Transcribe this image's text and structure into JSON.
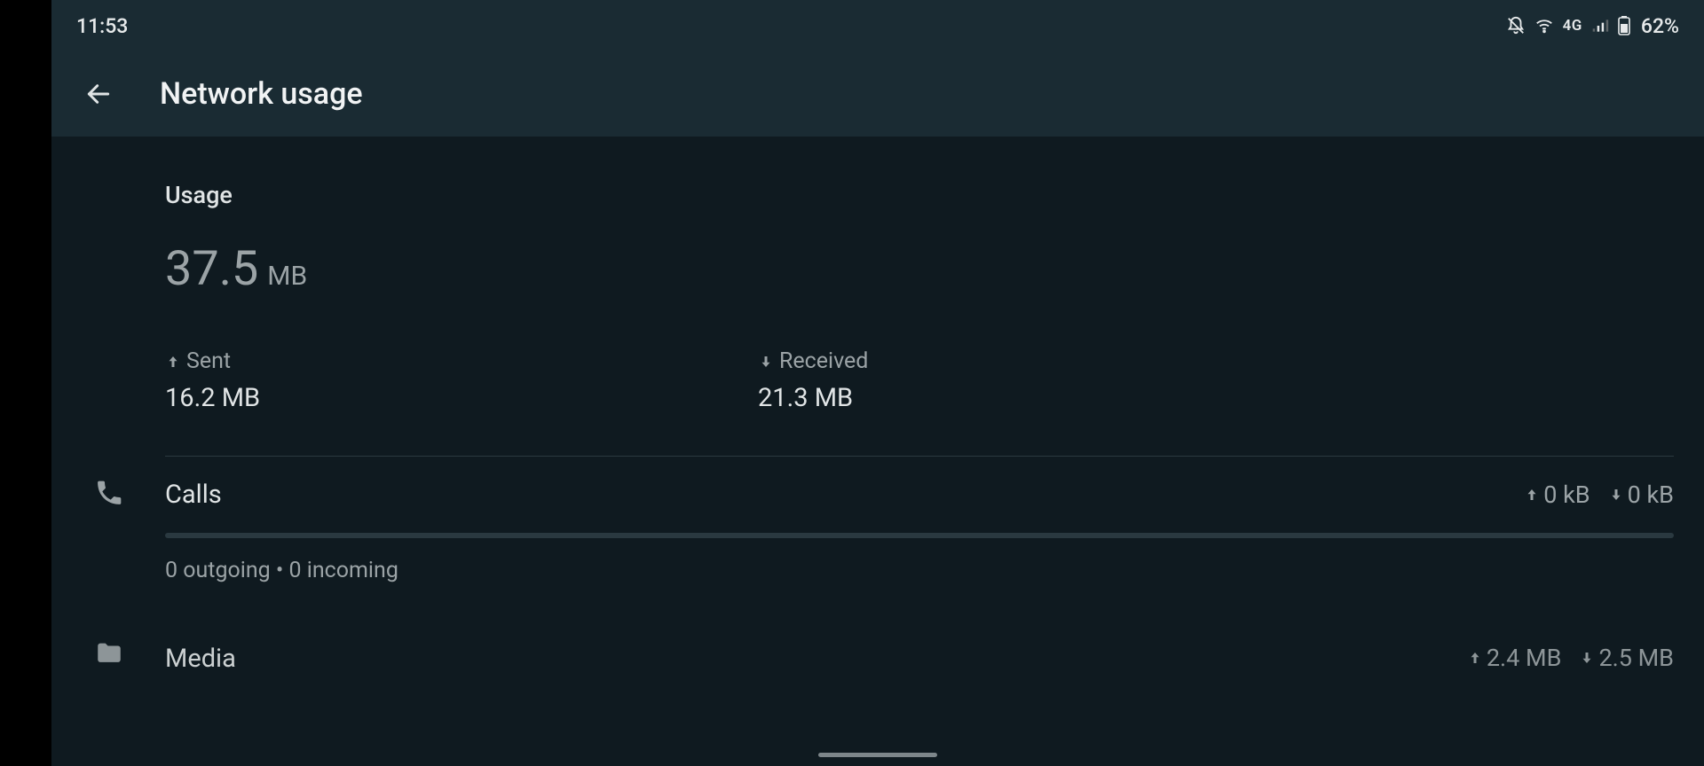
{
  "status": {
    "time": "11:53",
    "cell_label": "4G",
    "battery_text": "62%"
  },
  "header": {
    "title": "Network usage"
  },
  "usage": {
    "label": "Usage",
    "total_num": "37.5",
    "total_unit": "MB",
    "sent_label": "Sent",
    "sent_value": "16.2 MB",
    "recv_label": "Received",
    "recv_value": "21.3 MB"
  },
  "categories": [
    {
      "name": "Calls",
      "up": "0 kB",
      "down": "0 kB",
      "sub": "0 outgoing • 0 incoming"
    },
    {
      "name": "Media",
      "up": "2.4 MB",
      "down": "2.5 MB"
    }
  ]
}
